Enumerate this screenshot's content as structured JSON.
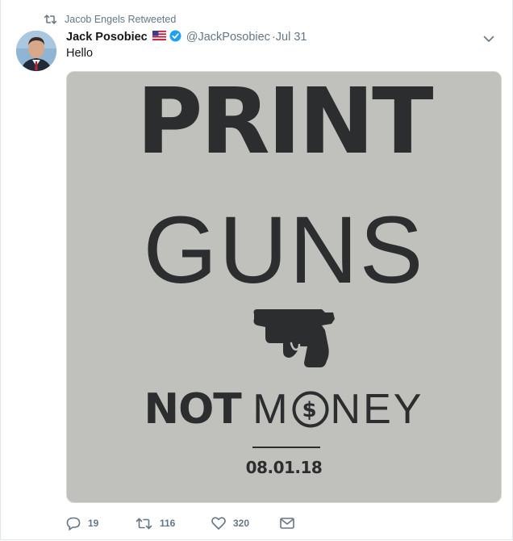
{
  "retweet": {
    "label": "Jacob Engels Retweeted",
    "icon": "retweet-icon"
  },
  "author": {
    "name": "Jack Posobiec",
    "handle": "@JackPosobiec",
    "separator": "·",
    "timestamp": "Jul 31",
    "flag_icon": "us-flag-icon",
    "verified_icon": "verified-badge-icon"
  },
  "tweet": {
    "text": "Hello"
  },
  "media": {
    "line1": "PRINT",
    "line2": "GUNS",
    "slogan_not": "NOT",
    "slogan_m": "M",
    "slogan_ney": "NEY",
    "date": "08.01.18",
    "background": "#c0c0bc",
    "ink": "#2c2d2e"
  },
  "actions": {
    "reply_count": "19",
    "retweet_count": "116",
    "like_count": "320"
  },
  "colors": {
    "muted": "#657786",
    "verified": "#1da1f2",
    "text": "#14171a"
  }
}
